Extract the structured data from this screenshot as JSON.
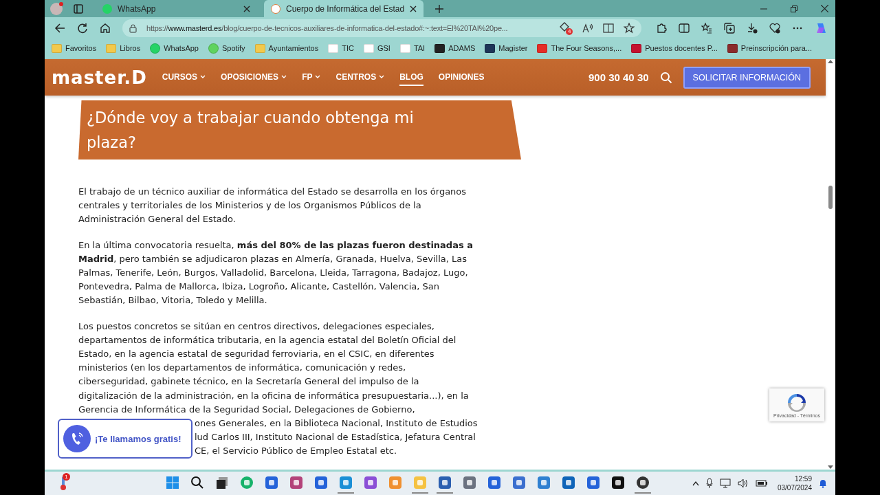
{
  "browser": {
    "tabs": [
      {
        "title": "WhatsApp",
        "kind": "whatsapp",
        "selected": false
      },
      {
        "title": "Cuerpo de Informática del Estad",
        "kind": "masterd",
        "selected": true
      }
    ],
    "address": "https://**www.masterd.es**/blog/cuerpo-de-tecnicos-auxiliares-de-informatica-del-estado#:~:text=El%20TAI%20pe...",
    "tracker_count": "4",
    "bookmarks": [
      {
        "label": "Favoritos",
        "kind": "folder"
      },
      {
        "label": "Libros",
        "kind": "folder"
      },
      {
        "label": "WhatsApp",
        "kind": "whatsapp"
      },
      {
        "label": "Spotify",
        "kind": "spotify"
      },
      {
        "label": "Ayuntamientos",
        "kind": "folder"
      },
      {
        "label": "TIC",
        "kind": "page"
      },
      {
        "label": "GSI",
        "kind": "page"
      },
      {
        "label": "TAI",
        "kind": "page"
      },
      {
        "label": "ADAMS",
        "kind": "adams"
      },
      {
        "label": "Magister",
        "kind": "magister"
      },
      {
        "label": "The Four Seasons,...",
        "kind": "youtube"
      },
      {
        "label": "Puestos docentes P...",
        "kind": "red"
      },
      {
        "label": "Preinscripción para...",
        "kind": "crest"
      }
    ]
  },
  "site": {
    "logo": "master.D",
    "nav": [
      {
        "label": "CURSOS",
        "dropdown": true,
        "selected": false
      },
      {
        "label": "OPOSICIONES",
        "dropdown": true,
        "selected": false
      },
      {
        "label": "FP",
        "dropdown": true,
        "selected": false
      },
      {
        "label": "CENTROS",
        "dropdown": true,
        "selected": false
      },
      {
        "label": "BLOG",
        "dropdown": false,
        "selected": true
      },
      {
        "label": "OPINIONES",
        "dropdown": false,
        "selected": false
      }
    ],
    "phone": "900 30 40 30",
    "cta": "SOLICITAR INFORMACIÓN"
  },
  "article": {
    "heading": "¿Dónde voy a trabajar cuando obtenga mi plaza?",
    "paragraphs": [
      [
        "El trabajo de un técnico auxiliar de informática del Estado se desarrolla en los órganos",
        "centrales y territoriales de los Ministerios y de los Organismos Públicos de la",
        "Administración General del Estado."
      ],
      [
        "En la última convocatoria resuelta, **más del 80% de las plazas fueron destinadas a**",
        "**Madrid**, pero también se adjudicaron plazas en Almería, Granada, Huelva, Sevilla, Las",
        "Palmas, Tenerife, León, Burgos, Valladolid, Barcelona, Lleida, Tarragona, Badajoz, Lugo,",
        "Pontevedra, Palma de Mallorca, Ibiza, Logroño, Alicante, Castellón, Valencia, San",
        "Sebastián, Bilbao, Vitoria, Toledo y Melilla."
      ],
      [
        "Los puestos concretos se sitúan en centros directivos, delegaciones especiales,",
        "departamentos de informática tributaria, en la agencia estatal del Boletín Oficial del",
        "Estado, en la agencia estatal de seguridad ferroviaria, en el CSIC, en diferentes",
        "ministerios (en los departamentos de informática, comunicación y redes,",
        "ciberseguridad, gabinete técnico, en la Secretaría General del impulso de la",
        "digitalización de la administración, en la oficina de informática presupuestaria...), en la",
        "Gerencia de Informática de la Seguridad Social, Delegaciones de Gobierno,"
      ]
    ],
    "covered_lines": [
      "ones Generales, en la Biblioteca Nacional, Instituto de Estudios",
      "lud Carlos III, Instituto Nacional de Estadística, Jefatura Central",
      "CE, el Servicio Público de Empleo Estatal etc."
    ]
  },
  "call_widget": "¡Te llamamos gratis!",
  "recaptcha": "Privacidad - Términos",
  "taskbar": {
    "weather_badge": "1",
    "apps": [
      {
        "kind": "windows",
        "running": false
      },
      {
        "kind": "search",
        "running": false
      },
      {
        "kind": "taskview",
        "running": false
      },
      {
        "kind": "green",
        "running": false
      },
      {
        "kind": "blue",
        "running": false
      },
      {
        "kind": "snip",
        "running": false
      },
      {
        "kind": "blue",
        "running": false
      },
      {
        "kind": "edge",
        "running": true
      },
      {
        "kind": "purple",
        "running": false
      },
      {
        "kind": "orange",
        "running": false
      },
      {
        "kind": "folder",
        "running": true
      },
      {
        "kind": "store",
        "running": true
      },
      {
        "kind": "calc",
        "running": false
      },
      {
        "kind": "blue",
        "running": false
      },
      {
        "kind": "shell",
        "running": false
      },
      {
        "kind": "mail",
        "running": false
      },
      {
        "kind": "outlook",
        "running": false
      },
      {
        "kind": "blue",
        "running": false
      },
      {
        "kind": "terminal",
        "running": false
      },
      {
        "kind": "obs",
        "running": true
      }
    ],
    "time": "12:59",
    "date": "03/07/2024"
  }
}
